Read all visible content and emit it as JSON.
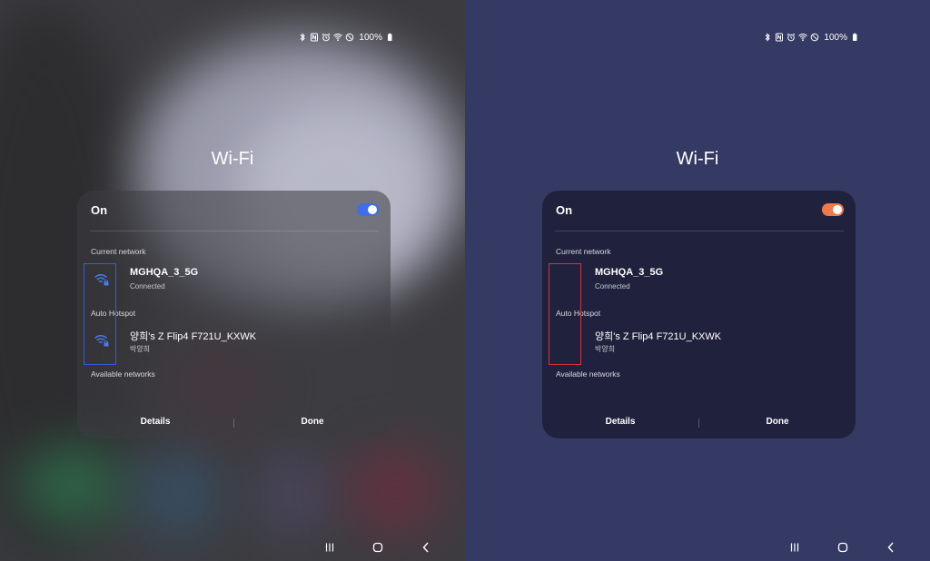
{
  "colors": {
    "left_accent": "#3e6ee8",
    "right_accent": "#ee7a4a",
    "left_highlight": "#3b58d8",
    "right_highlight": "#d8323c"
  },
  "panels": [
    {
      "id": "left",
      "status": {
        "battery": "100%",
        "icons": [
          "bluetooth-icon",
          "nfc-icon",
          "alarm-icon",
          "wifi-icon",
          "do-not-disturb-icon",
          "battery-icon"
        ]
      },
      "title": "Wi-Fi",
      "toggle_label": "On",
      "toggle_on": true,
      "current_label": "Current network",
      "current_network": {
        "name": "MGHQA_3_5G",
        "status": "Connected"
      },
      "hotspot_label": "Auto Hotspot",
      "hotspot_network": {
        "name": "양희's Z Flip4 F721U_KXWK",
        "owner": "박양희"
      },
      "available_label": "Available networks",
      "details_label": "Details",
      "done_label": "Done"
    },
    {
      "id": "right",
      "status": {
        "battery": "100%",
        "icons": [
          "bluetooth-icon",
          "nfc-icon",
          "alarm-icon",
          "wifi-icon",
          "do-not-disturb-icon",
          "battery-icon"
        ]
      },
      "title": "Wi-Fi",
      "toggle_label": "On",
      "toggle_on": true,
      "current_label": "Current network",
      "current_network": {
        "name": "MGHQA_3_5G",
        "status": "Connected"
      },
      "hotspot_label": "Auto Hotspot",
      "hotspot_network": {
        "name": "양희's Z Flip4 F721U_KXWK",
        "owner": "박양희"
      },
      "available_label": "Available networks",
      "details_label": "Details",
      "done_label": "Done"
    }
  ]
}
